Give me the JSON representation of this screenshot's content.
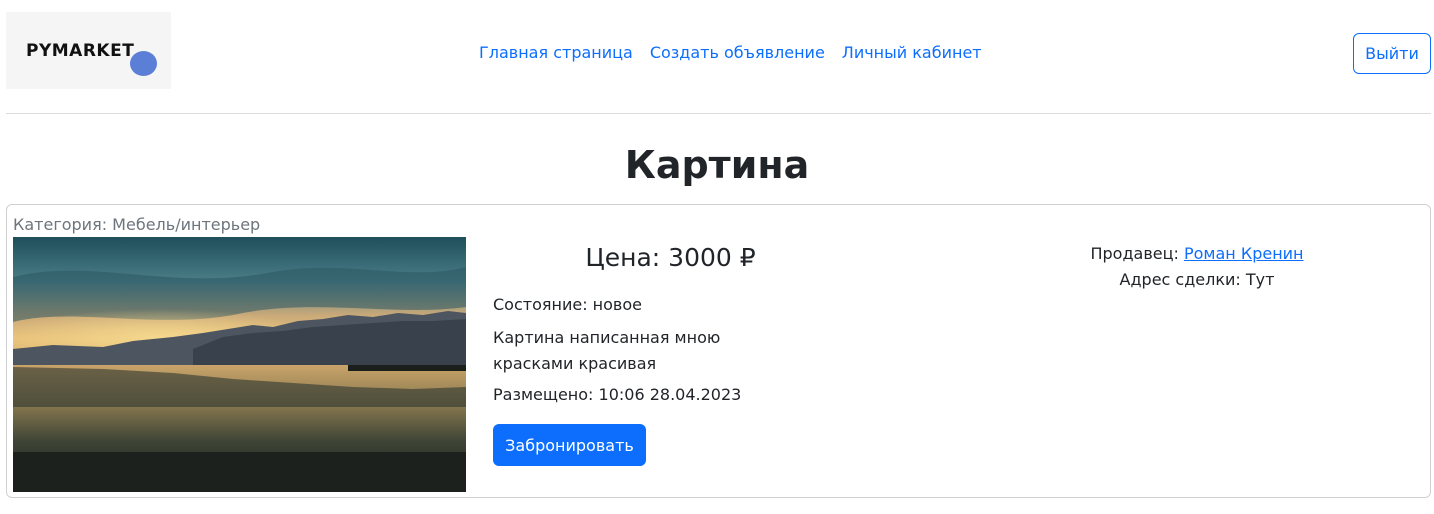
{
  "header": {
    "logo_text": "PYMARKET",
    "nav": [
      {
        "label": "Главная страница"
      },
      {
        "label": "Создать объявление"
      },
      {
        "label": "Личный кабинет"
      }
    ],
    "logout_label": "Выйти"
  },
  "listing": {
    "title": "Картина",
    "category": "Категория: Мебель/интерьер",
    "price": "Цена: 3000 ₽",
    "condition": "Состояние: новое",
    "description": "Картина написанная мною красками красивая",
    "posted": "Размещено: 10:06 28.04.2023",
    "book_label": "Забронировать",
    "seller_prefix": "Продавец: ",
    "seller_name": "Роман Кренин",
    "address": "Адрес сделки: Тут"
  },
  "colors": {
    "primary": "#0d6efd",
    "logo_dot": "#5b7fd6"
  }
}
